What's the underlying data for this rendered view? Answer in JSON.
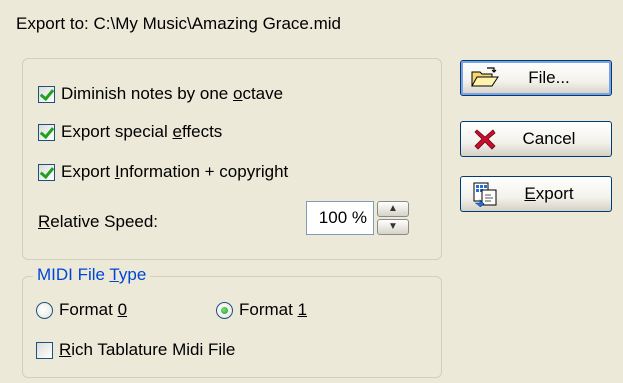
{
  "header": {
    "export_path": "Export to: C:\\My Music\\Amazing Grace.mid"
  },
  "options": {
    "diminish_prefix": "Diminish notes by one ",
    "diminish_underlined": "o",
    "diminish_suffix": "ctave",
    "diminish_checked": true,
    "special_prefix": "Export special ",
    "special_underlined": "e",
    "special_suffix": "ffects",
    "special_checked": true,
    "info_prefix": "Export ",
    "info_underlined": "I",
    "info_suffix": "nformation + copyright",
    "info_checked": true,
    "speed_underlined": "R",
    "speed_suffix": "elative Speed:",
    "speed_value": "100 %"
  },
  "midi": {
    "legend_prefix": "MIDI File ",
    "legend_underlined": "T",
    "legend_suffix": "ype",
    "format0_prefix": "Format ",
    "format0_underlined": "0",
    "format0_selected": false,
    "format1_prefix": "Format ",
    "format1_underlined": "1",
    "format1_selected": true,
    "rich_underlined": "R",
    "rich_suffix": "ich Tablature Midi File",
    "rich_checked": false
  },
  "buttons": {
    "file_label": "File...",
    "cancel_label": "Cancel",
    "export_underlined": "E",
    "export_suffix": "xport",
    "file_icon": "open-folder-icon",
    "cancel_icon": "red-x-icon",
    "export_icon": "export-document-icon"
  }
}
